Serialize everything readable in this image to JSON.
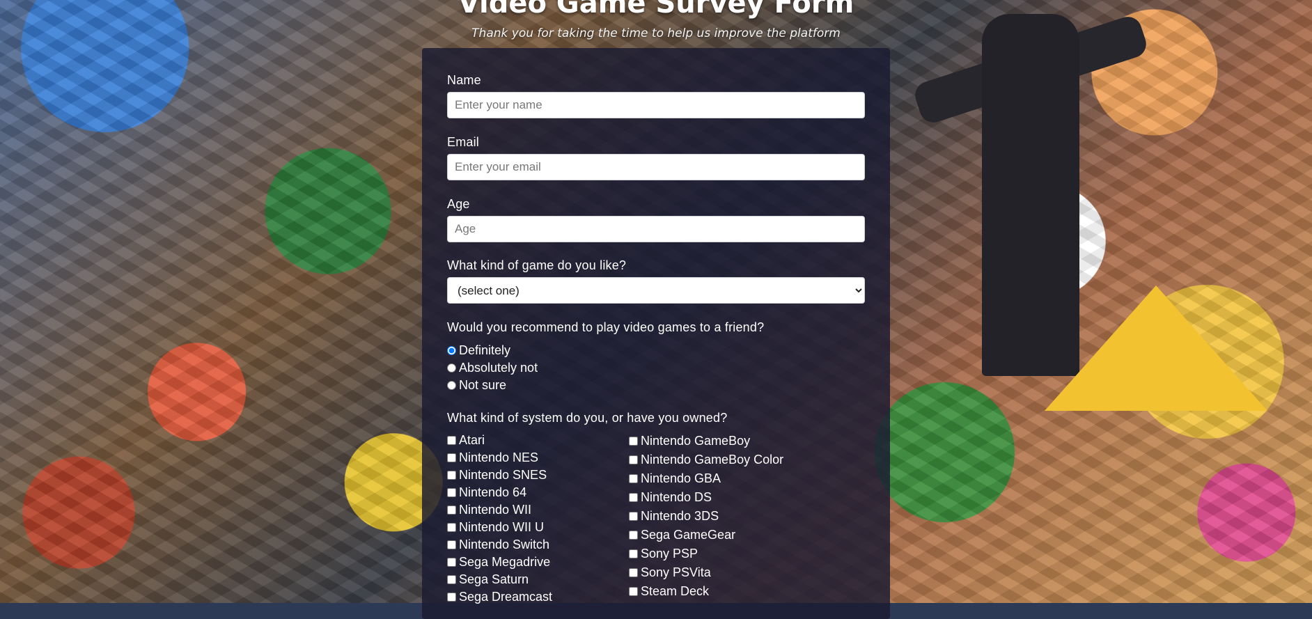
{
  "header": {
    "title": "Video Game Survey Form",
    "subtitle": "Thank you for taking the time to help us improve the platform"
  },
  "form": {
    "name": {
      "label": "Name",
      "placeholder": "Enter your name"
    },
    "email": {
      "label": "Email",
      "placeholder": "Enter your email"
    },
    "age": {
      "label": "Age",
      "placeholder": "Age"
    },
    "genre": {
      "label": "What kind of game do you like?",
      "selected": "(select one)"
    },
    "recommend": {
      "label": "Would you recommend to play video games to a friend?",
      "options": [
        "Definitely",
        "Absolutely not",
        "Not sure"
      ],
      "selected": "Definitely"
    },
    "systems": {
      "label": "What kind of system do you, or have you owned?",
      "left": [
        "Atari",
        "Nintendo NES",
        "Nintendo SNES",
        "Nintendo 64",
        "Nintendo WII",
        "Nintendo WII U",
        "Nintendo Switch",
        "Sega Megadrive",
        "Sega Saturn",
        "Sega Dreamcast"
      ],
      "right": [
        "Nintendo GameBoy",
        "Nintendo GameBoy Color",
        "Nintendo GBA",
        "Nintendo DS",
        "Nintendo 3DS",
        "Sega GameGear",
        "Sony PSP",
        "Sony PSVita",
        "Steam Deck"
      ]
    }
  }
}
